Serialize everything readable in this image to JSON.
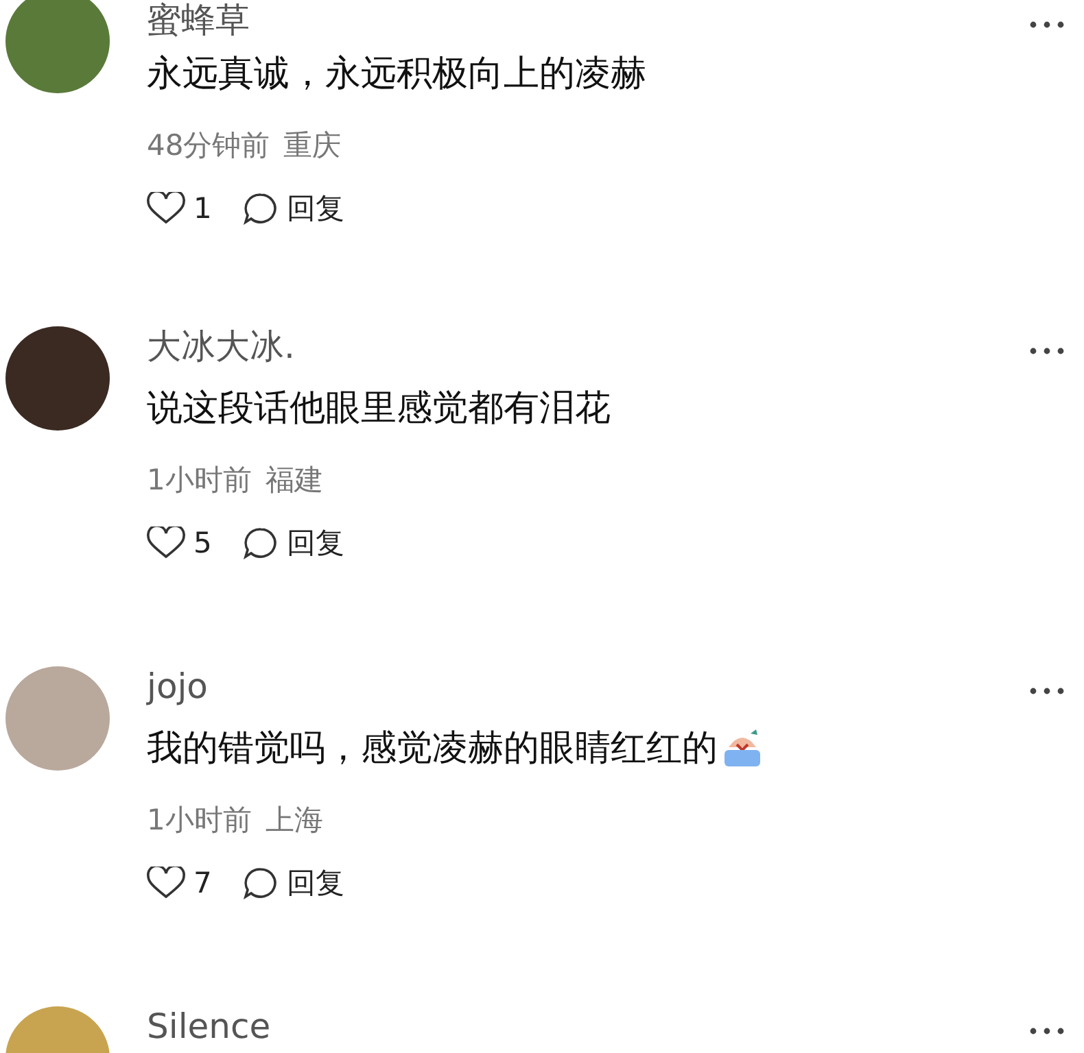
{
  "comments": [
    {
      "name": "蜜蜂草",
      "text": "永远真诚，永远积极向上的凌赫",
      "has_emoji": false,
      "time": "48分钟前",
      "location": "重庆",
      "likes": "1",
      "reply": "回复"
    },
    {
      "name": "大冰大冰.",
      "text": "说这段话他眼里感觉都有泪花",
      "has_emoji": false,
      "time": "1小时前",
      "location": "福建",
      "likes": "5",
      "reply": "回复"
    },
    {
      "name": "jojo",
      "text": "我的错觉吗，感觉凌赫的眼睛红红的",
      "has_emoji": true,
      "time": "1小时前",
      "location": "上海",
      "likes": "7",
      "reply": "回复"
    },
    {
      "name": "Silence"
    }
  ]
}
